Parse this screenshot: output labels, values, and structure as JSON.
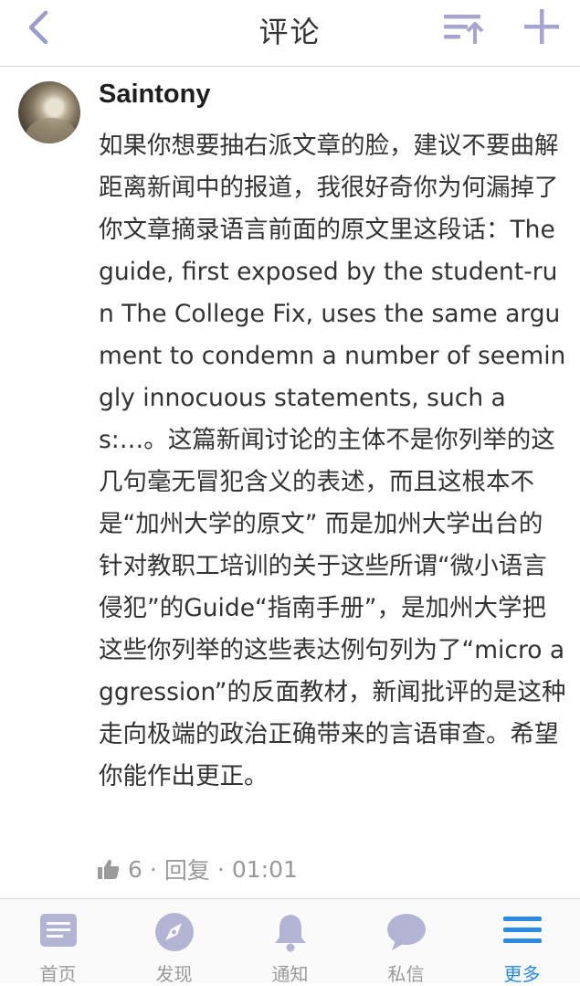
{
  "header": {
    "title": "评论"
  },
  "comment": {
    "username": "Saintony",
    "text": "如果你想要抽右派文章的脸，建议不要曲解距离新闻中的报道，我很好奇你为何漏掉了你文章摘录语言前面的原文里这段话：The guide, first exposed by the student-run The College Fix, uses the same argument to condemn a number of seemingly innocuous statements, such as:…。这篇新闻讨论的主体不是你列举的这几句毫无冒犯含义的表述，而且这根本不是“加州大学的原文” 而是加州大学出台的针对教职工培训的关于这些所谓“微小语言侵犯”的Guide“指南手册”，是加州大学把这些你列举的这些表达例句列为了“micro aggression”的反面教材，新闻批评的是这种走向极端的政治正确带来的言语审查。希望你能作出更正。",
    "likes": "6",
    "reply_label": "回复",
    "time": "01:01",
    "separator": "·"
  },
  "tabs": [
    {
      "label": "首页",
      "icon": "home-icon"
    },
    {
      "label": "发现",
      "icon": "compass-icon"
    },
    {
      "label": "通知",
      "icon": "bell-icon"
    },
    {
      "label": "私信",
      "icon": "chat-bubble-icon"
    },
    {
      "label": "更多",
      "icon": "menu-icon",
      "active": true
    }
  ],
  "colors": {
    "accent": "#2a8be0",
    "header_icon": "#9d9bc9",
    "tab_icon": "#b3b4d3",
    "meta_text": "#999999"
  }
}
